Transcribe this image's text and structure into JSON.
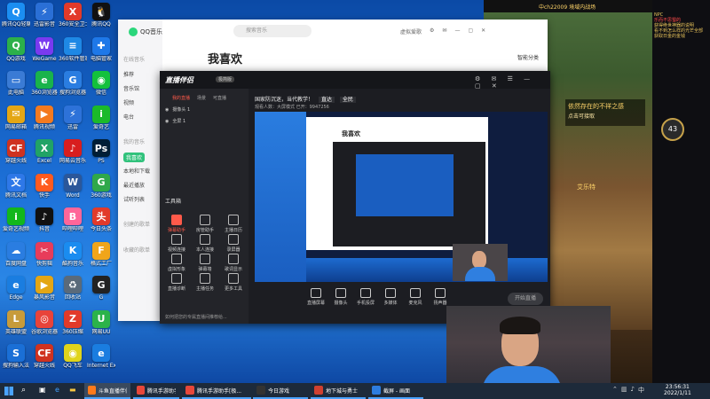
{
  "desktop": {
    "icons": [
      {
        "label": "腾讯QQ轻聊版",
        "color": "#1b8ef2",
        "glyph": "Q"
      },
      {
        "label": "迅雷影音",
        "color": "#2a6fd6",
        "glyph": "⚡"
      },
      {
        "label": "360安全卫士",
        "color": "#e23a2a",
        "glyph": "X"
      },
      {
        "label": "腾讯QQ",
        "color": "#111",
        "glyph": "🐧"
      },
      {
        "label": "QQ游戏",
        "color": "#2cb04a",
        "glyph": "Q"
      },
      {
        "label": "WeGame",
        "color": "#7a3af0",
        "glyph": "W"
      },
      {
        "label": "360软件管家",
        "color": "#1e88e5",
        "glyph": "≡"
      },
      {
        "label": "电脑管家",
        "color": "#1e78e8",
        "glyph": "✚"
      },
      {
        "label": "此电脑",
        "color": "#3a7bd5",
        "glyph": "▭"
      },
      {
        "label": "360浏览器",
        "color": "#19b34b",
        "glyph": "e"
      },
      {
        "label": "搜狗浏览器",
        "color": "#2a7de1",
        "glyph": "G"
      },
      {
        "label": "微信",
        "color": "#13c13c",
        "glyph": "◉"
      },
      {
        "label": "网易邮箱",
        "color": "#e4a614",
        "glyph": "✉"
      },
      {
        "label": "腾讯视频",
        "color": "#f47a1f",
        "glyph": "▶"
      },
      {
        "label": "迅雷",
        "color": "#2d72d9",
        "glyph": "⚡"
      },
      {
        "label": "爱奇艺",
        "color": "#1bba2a",
        "glyph": "i"
      },
      {
        "label": "穿越火线",
        "color": "#cf3220",
        "glyph": "CF"
      },
      {
        "label": "Excel",
        "color": "#21a366",
        "glyph": "X"
      },
      {
        "label": "网易云音乐",
        "color": "#d81e1e",
        "glyph": "♪"
      },
      {
        "label": "PS",
        "color": "#001e36",
        "glyph": "Ps"
      },
      {
        "label": "腾讯文档",
        "color": "#2e78e8",
        "glyph": "文"
      },
      {
        "label": "快手",
        "color": "#ff5a1f",
        "glyph": "K"
      },
      {
        "label": "Word",
        "color": "#2b579a",
        "glyph": "W"
      },
      {
        "label": "360游戏",
        "color": "#2fa84a",
        "glyph": "G"
      },
      {
        "label": "爱奇艺视频",
        "color": "#12b71c",
        "glyph": "i"
      },
      {
        "label": "抖音",
        "color": "#111",
        "glyph": "♪"
      },
      {
        "label": "哔哩哔哩",
        "color": "#ff6699",
        "glyph": "B"
      },
      {
        "label": "今日头条",
        "color": "#e23a2a",
        "glyph": "头"
      },
      {
        "label": "百度网盘",
        "color": "#2a7de1",
        "glyph": "☁"
      },
      {
        "label": "快剪辑",
        "color": "#e83c5a",
        "glyph": "✂"
      },
      {
        "label": "酷狗音乐",
        "color": "#1a8cf0",
        "glyph": "K"
      },
      {
        "label": "格式工厂",
        "color": "#f0a51a",
        "glyph": "F"
      },
      {
        "label": "Edge",
        "color": "#1a7de0",
        "glyph": "e"
      },
      {
        "label": "暴风影音",
        "color": "#e4a614",
        "glyph": "▶"
      },
      {
        "label": "回收站",
        "color": "#5a6a7a",
        "glyph": "♻"
      },
      {
        "label": "G",
        "color": "#222",
        "glyph": "G"
      },
      {
        "label": "英雄联盟",
        "color": "#c79b3b",
        "glyph": "L"
      },
      {
        "label": "谷歌浏览器",
        "color": "#e8433a",
        "glyph": "◎"
      },
      {
        "label": "360压缩",
        "color": "#e23a2a",
        "glyph": "Z"
      },
      {
        "label": "网易UU",
        "color": "#2bb34a",
        "glyph": "U"
      },
      {
        "label": "搜狗输入法",
        "color": "#1a6fd6",
        "glyph": "S"
      },
      {
        "label": "穿越火线",
        "color": "#cf3220",
        "glyph": "CF"
      },
      {
        "label": "QQ飞车",
        "color": "#e0d41a",
        "glyph": "◉"
      },
      {
        "label": "Internet Explorer",
        "color": "#1a7de0",
        "glyph": "e"
      }
    ]
  },
  "qq_music": {
    "app_name": "QQ音乐",
    "search_placeholder": "搜索音乐",
    "user": "虚拟爱歌",
    "title": "我喜欢",
    "share_button": "智能分类",
    "nav_sections": [
      {
        "head": "在线音乐",
        "items": [
          "推荐",
          "音乐馆",
          "视频",
          "电台"
        ]
      },
      {
        "head": "我的音乐",
        "items": [
          "我喜欢",
          "本地和下载",
          "最近播放",
          "试听列表"
        ]
      },
      {
        "head": "创建的歌单",
        "items": []
      },
      {
        "head": "收藏的歌单",
        "items": []
      }
    ],
    "active_nav": "我喜欢"
  },
  "streamer": {
    "app_name": "直播伴侣",
    "badge": "极简版",
    "tabs": [
      "我的直播",
      "场景",
      "可直播"
    ],
    "scenes": [
      "摄像头 1",
      "全屏 1"
    ],
    "tools_title": "工具箱",
    "tools": [
      "弹幕助手",
      "房管助手",
      "主播日历",
      "视频连接",
      "本人连接",
      "录屏器",
      "虚拟形象",
      "弹幕墙",
      "歌词显示",
      "直播诊断",
      "主播任务",
      "更多工具"
    ],
    "notice": "国家防沉迷，当代教学！",
    "notice_btn": "直达",
    "notice_btn2": "全民",
    "live_info": "观看人数：大屏模式  已开：9947256",
    "bottom_buttons": [
      "直播屏幕",
      "摄像头",
      "手机投屏",
      "多媒体",
      "麦克风",
      "扬声器"
    ],
    "start_button": "开始直播",
    "footer_text": "如何把您的专属直播间推荐给..."
  },
  "game": {
    "top_text": "中ch22009 境域内战场",
    "side_lines": [
      "NPC",
      "乐而不思蜀的",
      "获得绝世神器的说明",
      "看不到怎么样的光芒全部",
      "获取日金的金钱"
    ],
    "quest_text": "依然存在的不祥之感",
    "quest_sub": "点击可接取",
    "level": "43",
    "npc_name": "艾乐特"
  },
  "taskbar": {
    "items": [
      {
        "label": "斗鱼直播伴侣",
        "color": "#ff7a1a",
        "active": true
      },
      {
        "label": "腾讯手游助手",
        "color": "#e8473a",
        "active": false
      },
      {
        "label": "腾讯手游助手[极...",
        "color": "#e8473a",
        "active": false
      },
      {
        "label": "今日游戏",
        "color": "#333",
        "active": false
      },
      {
        "label": "地下城与勇士",
        "color": "#d04030",
        "active": false
      },
      {
        "label": "截屏 - 画面",
        "color": "#2d7de0",
        "active": false
      }
    ],
    "time": "23:56:31",
    "date": "2022/1/11"
  }
}
